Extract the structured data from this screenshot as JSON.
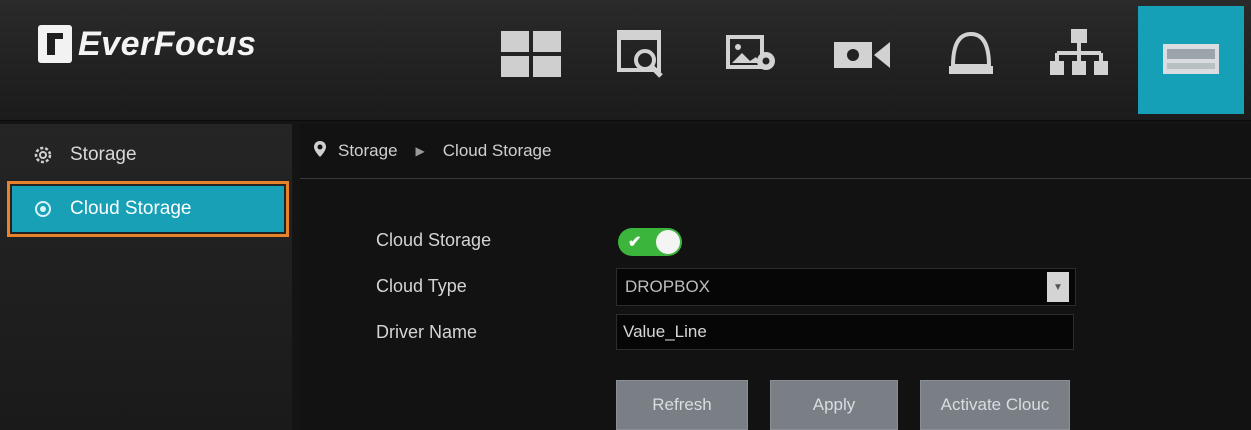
{
  "header": {
    "brand": "EverFocus",
    "nav_icons": [
      "layout-grid-icon",
      "playback-search-icon",
      "image-settings-icon",
      "camera-icon",
      "alarm-bell-icon",
      "network-icon",
      "storage-drive-icon"
    ],
    "active_icon": "storage-drive-icon",
    "accent_color": "#16a0b7"
  },
  "sidebar": {
    "items": [
      {
        "label": "Storage",
        "icon": "gear-icon"
      },
      {
        "label": "Cloud Storage",
        "icon": "cloud-icon",
        "selected": true
      }
    ],
    "highlight_color": "#e8832b"
  },
  "breadcrumb": {
    "items": [
      "Storage",
      "Cloud Storage"
    ]
  },
  "form": {
    "cloud_storage_label": "Cloud Storage",
    "cloud_storage_enabled": true,
    "cloud_type_label": "Cloud Type",
    "cloud_type_value": "DROPBOX",
    "driver_name_label": "Driver Name",
    "driver_name_value": "Value_Line"
  },
  "buttons": {
    "refresh": "Refresh",
    "apply": "Apply",
    "activate": "Activate Clouc"
  }
}
